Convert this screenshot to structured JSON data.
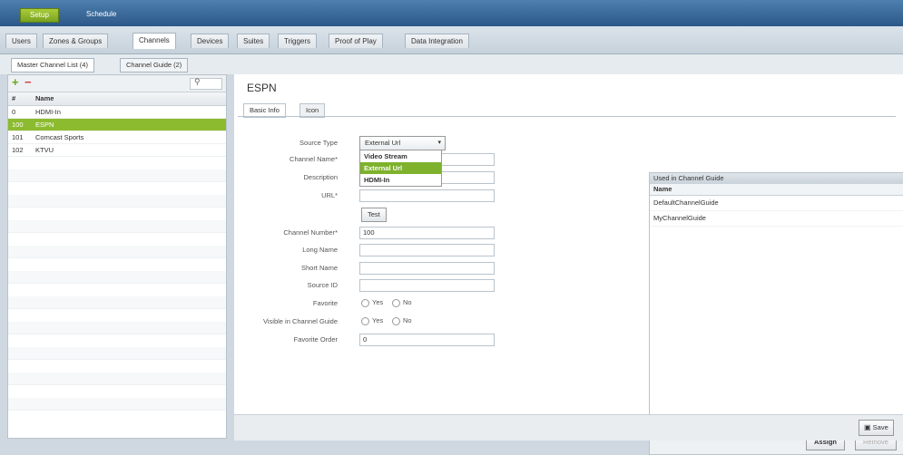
{
  "top_tabs": {
    "setup": "Setup",
    "schedule": "Schedule"
  },
  "main_tabs": [
    "Users",
    "Zones & Groups",
    "Channels",
    "Devices",
    "Suites",
    "Triggers",
    "Proof of Play",
    "Data Integration"
  ],
  "sub_tabs": [
    "Master Channel List (4)",
    "Channel Guide (2)"
  ],
  "channel_list": {
    "headers": {
      "num": "#",
      "name": "Name"
    },
    "rows": [
      {
        "num": "0",
        "name": "HDMI-In"
      },
      {
        "num": "100",
        "name": "ESPN"
      },
      {
        "num": "101",
        "name": "Comcast Sports"
      },
      {
        "num": "102",
        "name": "KTVU"
      }
    ]
  },
  "detail": {
    "title": "ESPN",
    "tabs": [
      "Basic Info",
      "Icon"
    ],
    "labels": {
      "source_type": "Source Type",
      "channel_name": "Channel Name*",
      "description": "Description",
      "url": "URL*",
      "channel_number": "Channel Number*",
      "long_name": "Long Name",
      "short_name": "Short Name",
      "source_id": "Source ID",
      "favorite": "Favorite",
      "visible": "Visible in Channel Guide",
      "favorite_order": "Favorite Order"
    },
    "source_type_value": "External Url",
    "source_type_options": [
      "Video Stream",
      "External Url",
      "HDMI-In"
    ],
    "test_button": "Test",
    "channel_number_value": "100",
    "favorite_order_value": "0",
    "radio_yes": "Yes",
    "radio_no": "No"
  },
  "used_in": {
    "title": "Used in Channel Guide",
    "header": "Name",
    "rows": [
      "DefaultChannelGuide",
      "MyChannelGuide"
    ],
    "assign": "Assign",
    "remove": "Remove"
  },
  "save_button": "Save",
  "colors": {
    "accent": "#8cbb2f",
    "header": "#2b5888"
  }
}
